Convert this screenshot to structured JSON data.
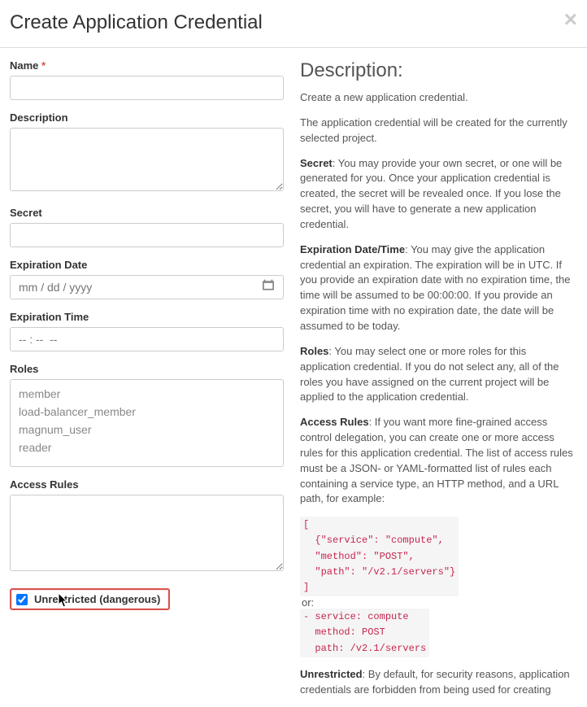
{
  "header": {
    "title": "Create Application Credential"
  },
  "form": {
    "name": {
      "label": "Name",
      "value": ""
    },
    "description": {
      "label": "Description",
      "value": ""
    },
    "secret": {
      "label": "Secret",
      "value": ""
    },
    "expiration_date": {
      "label": "Expiration Date",
      "placeholder": "mm / dd / yyyy",
      "value": ""
    },
    "expiration_time": {
      "label": "Expiration Time",
      "placeholder": "-- : --  --",
      "value": ""
    },
    "roles": {
      "label": "Roles",
      "options": [
        "member",
        "load-balancer_member",
        "magnum_user",
        "reader"
      ]
    },
    "access_rules": {
      "label": "Access Rules",
      "value": ""
    },
    "unrestricted": {
      "label": "Unrestricted (dangerous)",
      "checked": true
    }
  },
  "help": {
    "heading": "Description:",
    "intro": "Create a new application credential.",
    "project_note": "The application credential will be created for the currently selected project.",
    "secret": {
      "bold": "Secret",
      "text": ": You may provide your own secret, or one will be generated for you. Once your application credential is created, the secret will be revealed once. If you lose the secret, you will have to generate a new application credential."
    },
    "expiration": {
      "bold": "Expiration Date/Time",
      "text": ": You may give the application credential an expiration. The expiration will be in UTC. If you provide an expiration date with no expiration time, the time will be assumed to be 00:00:00. If you provide an expiration time with no expiration date, the date will be assumed to be today."
    },
    "roles": {
      "bold": "Roles",
      "text": ": You may select one or more roles for this application credential. If you do not select any, all of the roles you have assigned on the current project will be applied to the application credential."
    },
    "access_rules": {
      "bold": "Access Rules",
      "text": ": If you want more fine-grained access control delegation, you can create one or more access rules for this application credential. The list of access rules must be a JSON- or YAML-formatted list of rules each containing a service type, an HTTP method, and a URL path, for example:"
    },
    "code_json": "[\n  {\"service\": \"compute\",\n  \"method\": \"POST\",\n  \"path\": \"/v2.1/servers\"}\n]",
    "or": "or:",
    "code_yaml": "- service: compute\n  method: POST\n  path: /v2.1/servers",
    "unrestricted": {
      "bold": "Unrestricted",
      "text": ": By default, for security reasons, application credentials are forbidden from being used for creating"
    }
  }
}
